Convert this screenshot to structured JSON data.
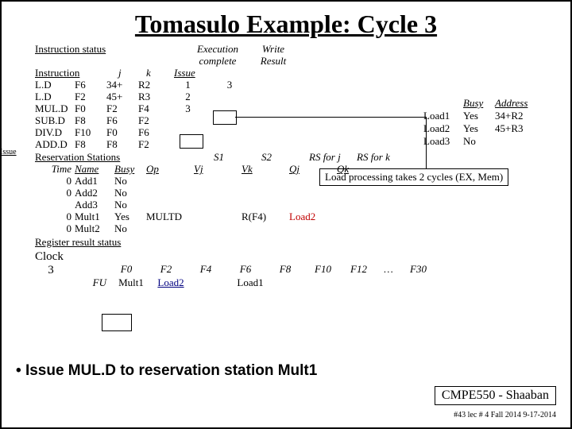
{
  "title": "Tomasulo Example:  Cycle 3",
  "headers": {
    "instr_status": "Instruction status",
    "instruction": "Instruction",
    "j": "j",
    "k": "k",
    "issue": "Issue",
    "exec": "Execution complete",
    "write": "Write Result",
    "busy": "Busy",
    "address": "Address"
  },
  "instructions": [
    {
      "op": "L.D",
      "dst": "F6",
      "j": "34+",
      "k": "R2",
      "issue": "1",
      "exec": "3",
      "write": ""
    },
    {
      "op": "L.D",
      "dst": "F2",
      "j": "45+",
      "k": "R3",
      "issue": "2",
      "exec": "",
      "write": ""
    },
    {
      "op": "MUL.D",
      "dst": "F0",
      "j": "F2",
      "k": "F4",
      "issue": "3",
      "exec": "",
      "write": ""
    },
    {
      "op": "SUB.D",
      "dst": "F8",
      "j": "F6",
      "k": "F2",
      "issue": "",
      "exec": "",
      "write": ""
    },
    {
      "op": "DIV.D",
      "dst": "F10",
      "j": "F0",
      "k": "F6",
      "issue": "",
      "exec": "",
      "write": ""
    },
    {
      "op": "ADD.D",
      "dst": "F8",
      "j": "F8",
      "k": "F2",
      "issue": "",
      "exec": "",
      "write": ""
    }
  ],
  "loads": [
    {
      "name": "Load1",
      "busy": "Yes",
      "addr": "34+R2"
    },
    {
      "name": "Load2",
      "busy": "Yes",
      "addr": "45+R3"
    },
    {
      "name": "Load3",
      "busy": "No",
      "addr": ""
    }
  ],
  "rs_hdr": {
    "title": "Reservation Stations",
    "time": "Time",
    "name": "Name",
    "busy": "Busy",
    "op": "Op",
    "s1": "S1",
    "vj": "Vj",
    "s2": "S2",
    "vk": "Vk",
    "rsj": "RS for j",
    "qj": "Qj",
    "rsk": "RS for k",
    "qk": "Qk"
  },
  "rs": [
    {
      "time": "0",
      "name": "Add1",
      "busy": "No",
      "op": "",
      "vj": "",
      "vk": "",
      "qj": "",
      "qk": ""
    },
    {
      "time": "0",
      "name": "Add2",
      "busy": "No",
      "op": "",
      "vj": "",
      "vk": "",
      "qj": "",
      "qk": ""
    },
    {
      "time": "",
      "name": "Add3",
      "busy": "No",
      "op": "",
      "vj": "",
      "vk": "",
      "qj": "",
      "qk": ""
    },
    {
      "time": "0",
      "name": "Mult1",
      "busy": "Yes",
      "op": "MULTD",
      "vj": "",
      "vk": "R(F4)",
      "qj": "Load2",
      "qk": ""
    },
    {
      "time": "0",
      "name": "Mult2",
      "busy": "No",
      "op": "",
      "vj": "",
      "vk": "",
      "qj": "",
      "qk": ""
    }
  ],
  "reg_title": "Register result status",
  "clock_label": "Clock",
  "clock": "3",
  "fu_label": "FU",
  "regs": [
    "F0",
    "F2",
    "F4",
    "F6",
    "F8",
    "F10",
    "F12",
    "…",
    "F30"
  ],
  "fu": [
    "Mult1",
    "Load2",
    "",
    "Load1",
    "",
    "",
    "",
    "",
    ""
  ],
  "issue_tag": "Issue",
  "annotation": "Load processing takes 2 cycles  (EX, Mem)",
  "bullet": "Issue MUL.D to reservation station Mult1",
  "footer1": "CMPE550 - Shaaban",
  "footer2": "#43  lec # 4 Fall 2014   9-17-2014"
}
